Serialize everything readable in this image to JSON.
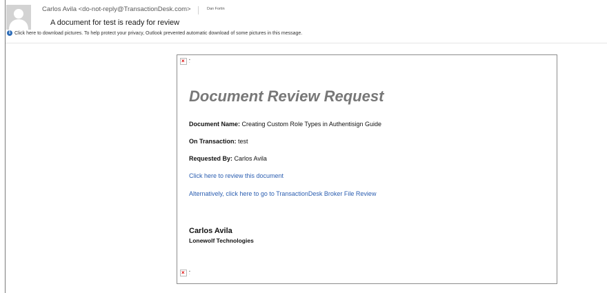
{
  "header": {
    "sender": "Carlos Avila <do-not-reply@TransactionDesk.com>",
    "recipient": "Dan Fortin",
    "subject": "A document for test is ready for review",
    "info_bar": "Click here to download pictures. To help protect your privacy, Outlook prevented automatic download of some pictures in this message.",
    "info_icon": "info-icon",
    "avatar_icon": "person-silhouette-icon"
  },
  "body": {
    "title": "Document Review Request",
    "document_name_label": "Document Name:",
    "document_name_value": "Creating Custom Role Types in Authentisign Guide",
    "transaction_label": "On Transaction:",
    "transaction_value": "test",
    "requested_by_label": "Requested By:",
    "requested_by_value": "Carlos Avila",
    "review_link": "Click here to review this document",
    "broker_link": "Alternatively, click here to go to TransactionDesk Broker File Review",
    "signature_name": "Carlos Avila",
    "signature_company": "Lonewolf Technologies",
    "broken_image_icon": "broken-image-icon"
  },
  "colors": {
    "link": "#2a5db0",
    "title": "#777777",
    "info_icon": "#2e6db8"
  }
}
